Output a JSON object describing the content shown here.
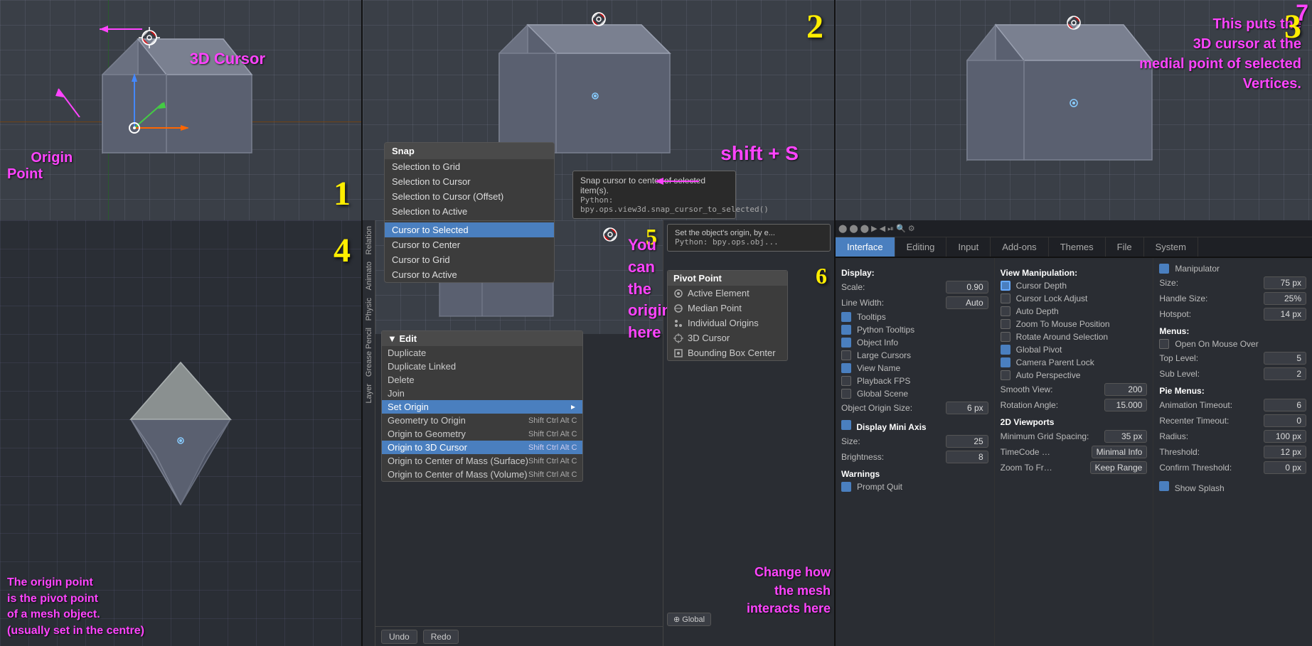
{
  "panels": {
    "p1": {
      "num": "1",
      "annotations": {
        "cursor_label": "3D Cursor",
        "origin_label": "Origin\nPoint"
      }
    },
    "p2": {
      "num": "2",
      "annotation": "shift + S",
      "snap_menu": {
        "title": "Snap",
        "items": [
          "Selection to Grid",
          "Selection to Cursor",
          "Selection to Cursor (Offset)",
          "Selection to Active",
          "Cursor to Selected",
          "Cursor to Center",
          "Cursor to Grid",
          "Cursor to Active"
        ],
        "active_index": 4,
        "tooltip_text": "Snap cursor to center of selected item(s).",
        "tooltip_python": "Python: bpy.ops.view3d.snap_cursor_to_selected()"
      }
    },
    "p3": {
      "num": "3",
      "annotation": "This puts the\n3D cursor at the\nmedial point of selected\nVertices."
    },
    "p4": {
      "num": "4",
      "annotation": "The origin point\nis the pivot point\nof a mesh object.\n(usually set in the centre)"
    },
    "p5": {
      "num": "5",
      "annotation": "You can the\norigin here",
      "edit_menu": {
        "title": "▼ Edit",
        "items": [
          {
            "label": "Duplicate",
            "shortcut": ""
          },
          {
            "label": "Duplicate Linked",
            "shortcut": ""
          },
          {
            "label": "Delete",
            "shortcut": ""
          },
          {
            "label": "Join",
            "shortcut": ""
          },
          {
            "label": "Set Origin",
            "shortcut": "",
            "highlighted": false,
            "has_arrow": true
          },
          {
            "label": "Geometry to Origin",
            "shortcut": "Shift Ctrl Alt C"
          },
          {
            "label": "Origin to Geometry",
            "shortcut": "Shift Ctrl Alt C"
          },
          {
            "label": "Origin to 3D Cursor",
            "shortcut": "Shift Ctrl Alt C",
            "highlighted": true
          },
          {
            "label": "Origin to Center of Mass (Surface)",
            "shortcut": "Shift Ctrl Alt C"
          },
          {
            "label": "Origin to Center of Mass (Volume)",
            "shortcut": "Shift Ctrl Alt C"
          }
        ]
      }
    },
    "p6": {
      "num": "6",
      "annotation": "Change how\nthe mesh\ninteracts here",
      "pivot_menu": {
        "title": "Pivot Point",
        "items": [
          "Active Element",
          "Median Point",
          "Individual Origins",
          "3D Cursor",
          "Bounding Box Center"
        ]
      },
      "bottom_buttons": {
        "undo": "Undo",
        "redo": "Redo"
      },
      "tooltip_text": "Set the object's origin, by e...",
      "tooltip_python": "Python: bpy.ops.obj..."
    },
    "p7": {
      "num": "7",
      "annotation": "7",
      "settings": {
        "tabs": [
          "Interface",
          "Editing",
          "Input",
          "Add-ons",
          "Themes",
          "File",
          "System"
        ],
        "active_tab": "Interface",
        "display_section": {
          "title": "Display:",
          "fields": [
            {
              "label": "Scale:",
              "value": "0.90"
            },
            {
              "label": "Line Width:",
              "value": "Auto"
            }
          ],
          "checkboxes": [
            {
              "label": "Tooltips",
              "checked": true
            },
            {
              "label": "Python Tooltips",
              "checked": true
            },
            {
              "label": "Object Info",
              "checked": true
            },
            {
              "label": "Large Cursors",
              "checked": false
            },
            {
              "label": "View Name",
              "checked": true
            },
            {
              "label": "Playback FPS",
              "checked": false
            },
            {
              "label": "Global Scene",
              "checked": false
            }
          ],
          "object_origin_size": "6 px"
        },
        "mini_axis_section": {
          "title": "Display Mini Axis",
          "checked": true,
          "size": "25",
          "brightness": "8"
        },
        "warnings_section": {
          "title": "Warnings",
          "prompt_quit": true
        },
        "view_manipulation": {
          "title": "View Manipulation:",
          "checkboxes": [
            {
              "label": "Cursor Depth",
              "checked": true
            },
            {
              "label": "Cursor Lock Adjust",
              "checked": false
            },
            {
              "label": "Auto Depth",
              "checked": false
            },
            {
              "label": "Zoom To Mouse Position",
              "checked": false
            },
            {
              "label": "Rotate Around Selection",
              "checked": false
            },
            {
              "label": "Global Pivot",
              "checked": true
            },
            {
              "label": "Camera Parent Lock",
              "checked": true
            },
            {
              "label": "Auto Perspective",
              "checked": false
            },
            {
              "label": "Smooth View:",
              "value": "200"
            },
            {
              "label": "Rotation Angle:",
              "value": "15.000"
            }
          ]
        },
        "mini_axis_right": {
          "title": "2D Viewports",
          "min_grid_spacing": "35 px",
          "timecode": "Minimal Info",
          "zoom_to_frame": "Keep Range"
        },
        "manipulator_section": {
          "title": "Manipulator",
          "checked": true,
          "size": "75 px",
          "handle_size": "25%",
          "hotspot": "14 px"
        },
        "menus_section": {
          "title": "Menus:",
          "open_on_mouse": false,
          "top_level": "5",
          "sub_level": "2"
        },
        "pie_menus_section": {
          "title": "Pie Menus:",
          "animation_timeout": "6",
          "recenter_timeout": "0",
          "radius": "100 px",
          "threshold": "12 px",
          "confirm_threshold": "0 px"
        },
        "show_splash": true
      }
    }
  }
}
